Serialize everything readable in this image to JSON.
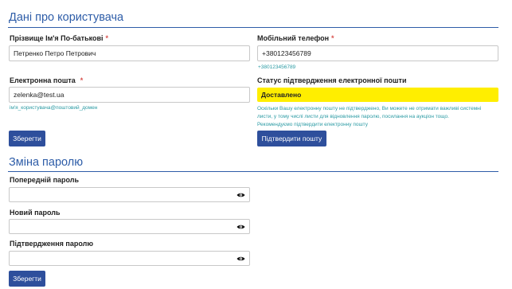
{
  "user_section": {
    "title": "Дані про користувача",
    "full_name": {
      "label": "Прізвище Ім'я По-батькові",
      "required_mark": "*",
      "value": "Петренко Петро Петрович"
    },
    "phone": {
      "label": "Мобільний телефон",
      "required_mark": "*",
      "value": "+380123456789",
      "hint": "+380123456789"
    },
    "email": {
      "label": "Електронна пошта",
      "required_mark": "*",
      "value": "zelenka@test.ua",
      "hint": "ім'я_користувача@поштовий_домен"
    },
    "email_status": {
      "label": "Статус підтвердження електронної пошти",
      "value": "Доставлено",
      "note_lines": [
        "Оскільки Вашу електронну пошту не підтверджено, Ви можете не отримати важливі системні",
        "листи, у тому числі листи для відновлення паролю, посилання на аукціон тощо.",
        "Рекомендуємо підтвердити електронну пошту"
      ]
    },
    "save_label": "Зберегти",
    "confirm_email_label": "Підтвердити пошту"
  },
  "password_section": {
    "title": "Зміна паролю",
    "previous_label": "Попередній пароль",
    "new_label": "Новий пароль",
    "confirm_label": "Підтвердження паролю",
    "save_label": "Зберегти"
  },
  "colors": {
    "accent": "#2e5da8",
    "button": "#2e4f9c",
    "status_bg": "#ffee00",
    "hint": "#2a9aa3",
    "required": "#d9534f"
  },
  "icons": {
    "visibility": "eye-icon"
  }
}
